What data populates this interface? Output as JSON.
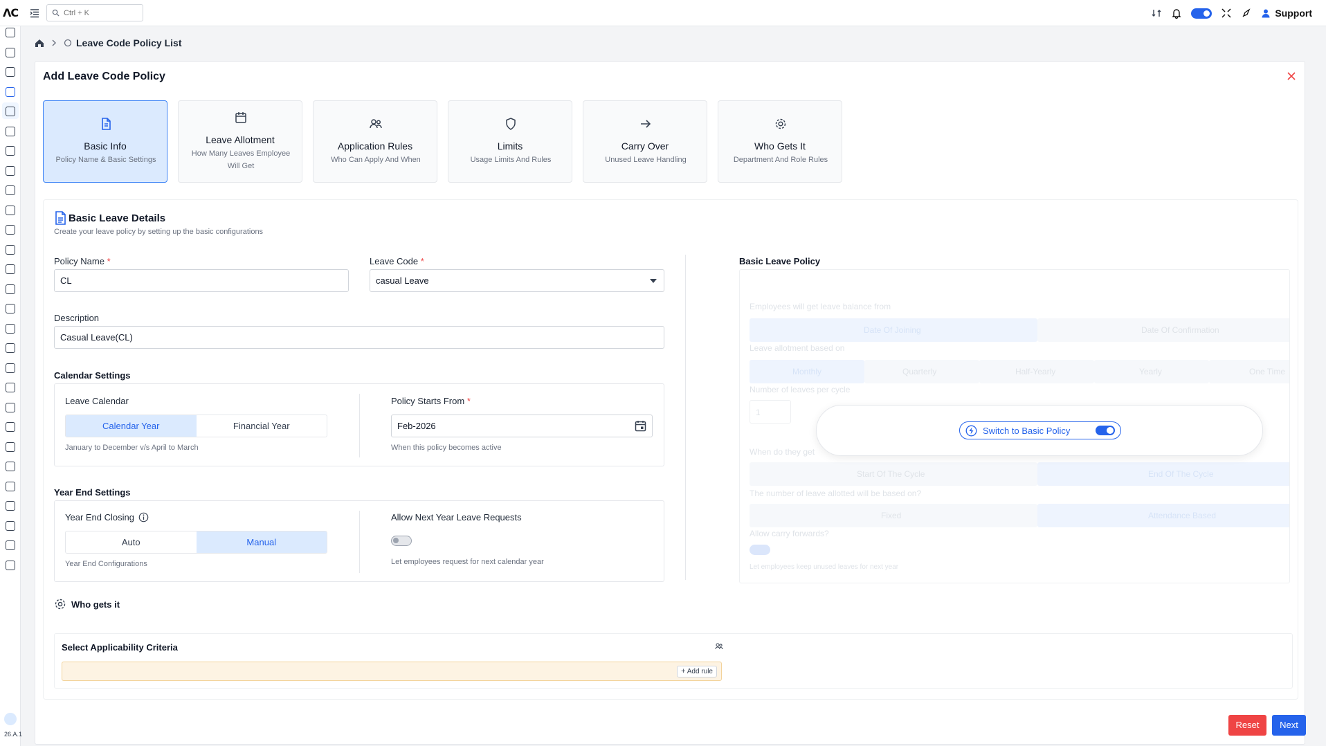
{
  "app": {
    "logo": "ΛC",
    "search_placeholder": "Ctrl + K",
    "support_label": "Support",
    "version": "26.A.1"
  },
  "breadcrumb": {
    "current": "Leave Code Policy List"
  },
  "modal": {
    "title": "Add Leave Code Policy"
  },
  "steps": [
    {
      "title": "Basic Info",
      "subtitle": "Policy Name & Basic Settings",
      "icon": "document-icon"
    },
    {
      "title": "Leave Allotment",
      "subtitle": "How Many Leaves Employee Will Get",
      "icon": "calendar-icon"
    },
    {
      "title": "Application Rules",
      "subtitle": "Who Can Apply And When",
      "icon": "users-icon"
    },
    {
      "title": "Limits",
      "subtitle": "Usage Limits And Rules",
      "icon": "shield-icon"
    },
    {
      "title": "Carry Over",
      "subtitle": "Unused Leave Handling",
      "icon": "arrow-right-icon"
    },
    {
      "title": "Who Gets It",
      "subtitle": "Department And Role Rules",
      "icon": "gear-icon"
    }
  ],
  "basic": {
    "title": "Basic Leave Details",
    "subtitle": "Create your leave policy by setting up the basic configurations",
    "policy_name_label": "Policy Name",
    "policy_name_value": "CL",
    "leave_code_label": "Leave Code",
    "leave_code_value": "casual Leave",
    "description_label": "Description",
    "description_value": "Casual Leave(CL)",
    "required_mark": "*"
  },
  "calendar": {
    "title": "Calendar Settings",
    "leave_calendar_label": "Leave Calendar",
    "options": [
      "Calendar Year",
      "Financial Year"
    ],
    "selected": "Calendar Year",
    "hint": "January to December v/s April to March",
    "starts_from_label": "Policy Starts From",
    "starts_from_value": "Feb-2026",
    "starts_from_hint": "When this policy becomes active"
  },
  "year_end": {
    "title": "Year End Settings",
    "closing_label": "Year End Closing",
    "options": [
      "Auto",
      "Manual"
    ],
    "selected": "Manual",
    "closing_hint": "Year End Configurations",
    "next_year_label": "Allow Next Year Leave Requests",
    "next_year_enabled": false,
    "next_year_hint": "Let employees request for next calendar year"
  },
  "basic_policy": {
    "title": "Basic Leave Policy",
    "switch_label": "Switch to Basic Policy",
    "switch_enabled": true,
    "ghost": {
      "balance_from": "Employees will get leave balance from",
      "balance_options": [
        "Date Of Joining",
        "Date Of Confirmation"
      ],
      "allotment_based_on": "Leave allotment based on",
      "allotment_options": [
        "Monthly",
        "Quarterly",
        "Half-Yearly",
        "Yearly",
        "One Time"
      ],
      "per_cycle": "Number of leaves per cycle",
      "per_cycle_value": "1",
      "when_get": "When do they get",
      "cycle_options": [
        "Start Of The Cycle",
        "End Of The Cycle"
      ],
      "allotted_based": "The number of leave allotted will be based on?",
      "allotted_options": [
        "Fixed",
        "Attendance Based"
      ],
      "carry_forward": "Allow carry forwards?",
      "carry_hint": "Let employees keep unused leaves for next year"
    }
  },
  "who_gets_it": {
    "title": "Who gets it",
    "criteria_label": "Select Applicability Criteria",
    "add_rule_label": "Add rule"
  },
  "actions": {
    "reset": "Reset",
    "next": "Next"
  },
  "colors": {
    "primary": "#2563eb",
    "danger": "#ef4444",
    "active_step_bg": "#dbeafe",
    "criteria_bg": "#fdf3e3"
  }
}
